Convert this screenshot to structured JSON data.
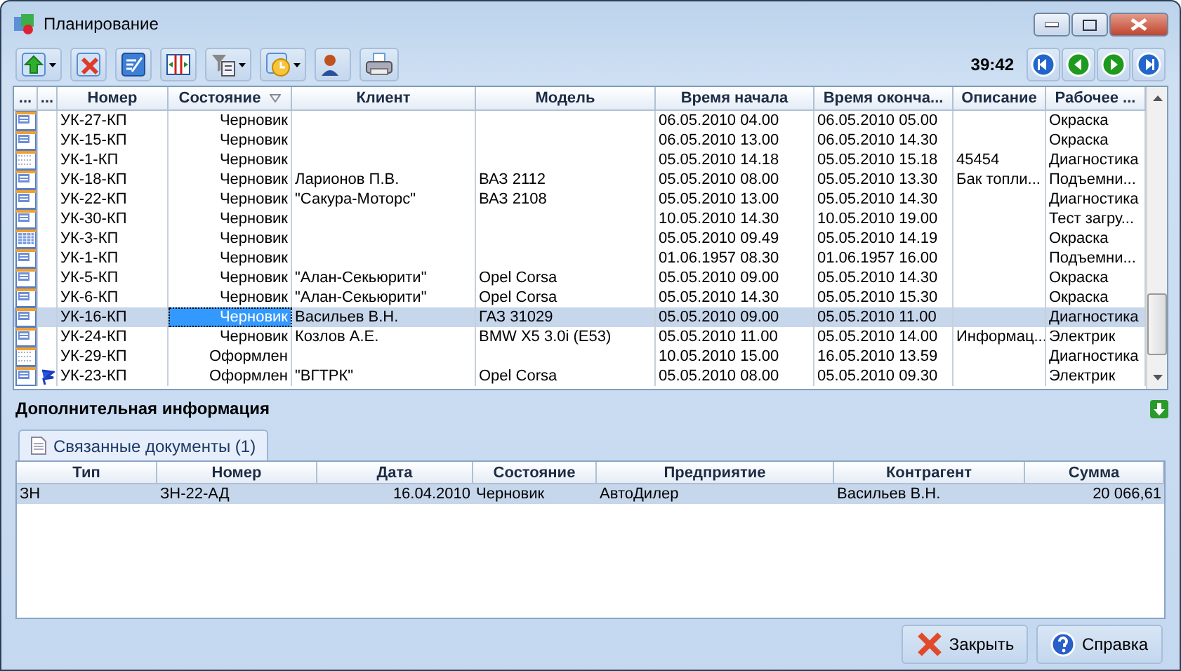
{
  "window": {
    "title": "Планирование"
  },
  "toolbar": {
    "buttons": [
      {
        "kind": "up",
        "dropdown": true
      },
      {
        "kind": "delete",
        "dropdown": false
      },
      {
        "kind": "edit",
        "dropdown": false
      },
      {
        "kind": "split",
        "dropdown": false
      },
      {
        "kind": "filter",
        "dropdown": true
      },
      {
        "kind": "clock",
        "dropdown": true
      },
      {
        "kind": "person",
        "dropdown": false
      },
      {
        "kind": "print",
        "dropdown": false
      }
    ],
    "timer": "39:42",
    "nav": [
      {
        "kind": "first"
      },
      {
        "kind": "prev"
      },
      {
        "kind": "next"
      },
      {
        "kind": "last"
      }
    ]
  },
  "grid": {
    "columns": [
      {
        "label": "...",
        "sorted": false
      },
      {
        "label": "...",
        "sorted": false
      },
      {
        "label": "Номер",
        "sorted": false
      },
      {
        "label": "Состояние",
        "sorted": true
      },
      {
        "label": "Клиент",
        "sorted": false
      },
      {
        "label": "Модель",
        "sorted": false
      },
      {
        "label": "Время начала",
        "sorted": false
      },
      {
        "label": "Время оконча...",
        "sorted": false
      },
      {
        "label": "Описание",
        "sorted": false
      },
      {
        "label": "Рабочее ...",
        "sorted": false
      }
    ],
    "rows": [
      {
        "kind": "grid",
        "flagged": false,
        "selected": false,
        "cells": [
          "",
          "",
          "УК-27-КП",
          "Черновик",
          "",
          "",
          "06.05.2010 04.00",
          "06.05.2010 05.00",
          "",
          "Окраска"
        ]
      },
      {
        "kind": "grid",
        "flagged": false,
        "selected": false,
        "cells": [
          "",
          "",
          "УК-15-КП",
          "Черновик",
          "",
          "",
          "06.05.2010 13.00",
          "06.05.2010 14.30",
          "",
          "Окраска"
        ]
      },
      {
        "kind": "dotted",
        "flagged": false,
        "selected": false,
        "cells": [
          "",
          "",
          "УК-1-КП",
          "Черновик",
          "",
          "",
          "05.05.2010 14.18",
          "05.05.2010 15.18",
          "45454",
          "Диагностика"
        ]
      },
      {
        "kind": "grid",
        "flagged": false,
        "selected": false,
        "cells": [
          "",
          "",
          "УК-18-КП",
          "Черновик",
          "Ларионов П.В.",
          "ВАЗ 2112",
          "05.05.2010 08.00",
          "05.05.2010 13.30",
          "Бак топли...",
          "Подъемни..."
        ]
      },
      {
        "kind": "grid",
        "flagged": false,
        "selected": false,
        "cells": [
          "",
          "",
          "УК-22-КП",
          "Черновик",
          "\"Сакура-Моторс\"",
          "ВАЗ 2108",
          "05.05.2010 13.00",
          "05.05.2010 14.30",
          "",
          "Диагностика"
        ]
      },
      {
        "kind": "grid",
        "flagged": false,
        "selected": false,
        "cells": [
          "",
          "",
          "УК-30-КП",
          "Черновик",
          "",
          "",
          "10.05.2010 14.30",
          "10.05.2010 19.00",
          "",
          "Тест загру..."
        ]
      },
      {
        "kind": "dense",
        "flagged": false,
        "selected": false,
        "cells": [
          "",
          "",
          "УК-3-КП",
          "Черновик",
          "",
          "",
          "05.05.2010 09.49",
          "05.05.2010 14.19",
          "",
          "Окраска"
        ]
      },
      {
        "kind": "grid",
        "flagged": false,
        "selected": false,
        "cells": [
          "",
          "",
          "УК-1-КП",
          "Черновик",
          "",
          "",
          "01.06.1957 08.30",
          "01.06.1957 16.00",
          "",
          "Подъемни..."
        ]
      },
      {
        "kind": "grid",
        "flagged": false,
        "selected": false,
        "cells": [
          "",
          "",
          "УК-5-КП",
          "Черновик",
          "\"Алан-Секьюрити\"",
          "Opel Corsa",
          "05.05.2010 09.00",
          "05.05.2010 14.30",
          "",
          "Окраска"
        ]
      },
      {
        "kind": "grid",
        "flagged": false,
        "selected": false,
        "cells": [
          "",
          "",
          "УК-6-КП",
          "Черновик",
          "\"Алан-Секьюрити\"",
          "Opel Corsa",
          "05.05.2010 14.30",
          "05.05.2010 15.30",
          "",
          "Окраска"
        ]
      },
      {
        "kind": "grid",
        "flagged": false,
        "selected": true,
        "cells": [
          "",
          "",
          "УК-16-КП",
          "Черновик",
          "Васильев В.Н.",
          "ГАЗ 31029",
          "05.05.2010 09.00",
          "05.05.2010 11.00",
          "",
          "Диагностика"
        ]
      },
      {
        "kind": "grid",
        "flagged": false,
        "selected": false,
        "cells": [
          "",
          "",
          "УК-24-КП",
          "Черновик",
          "Козлов А.Е.",
          "BMW X5 3.0i (E53)",
          "05.05.2010 11.00",
          "05.05.2010 14.00",
          "Информац...",
          "Электрик"
        ]
      },
      {
        "kind": "dotted",
        "flagged": false,
        "selected": false,
        "cells": [
          "",
          "",
          "УК-29-КП",
          "Оформлен",
          "",
          "",
          "10.05.2010 15.00",
          "16.05.2010 13.59",
          "",
          "Диагностика"
        ]
      },
      {
        "kind": "grid",
        "flagged": true,
        "selected": false,
        "cells": [
          "",
          "",
          "УК-23-КП",
          "Оформлен",
          "\"ВГТРК\"",
          "Opel Corsa",
          "05.05.2010 08.00",
          "05.05.2010 09.30",
          "",
          "Электрик"
        ]
      }
    ]
  },
  "details": {
    "title": "Дополнительная информация",
    "tabs": [
      {
        "label": "Связанные документы (1)",
        "selected": true
      }
    ],
    "columns": [
      "Тип",
      "Номер",
      "Дата",
      "Состояние",
      "Предприятие",
      "Контрагент",
      "Сумма"
    ],
    "rows": [
      {
        "selected": true,
        "cells": [
          "ЗН",
          "ЗН-22-АД",
          "16.04.2010",
          "Черновик",
          "АвтоДилер",
          "Васильев В.Н.",
          "20 066,61"
        ]
      }
    ]
  },
  "buttons": [
    {
      "kind": "close",
      "label": "Закрыть"
    },
    {
      "kind": "help",
      "label": "Справка"
    }
  ]
}
